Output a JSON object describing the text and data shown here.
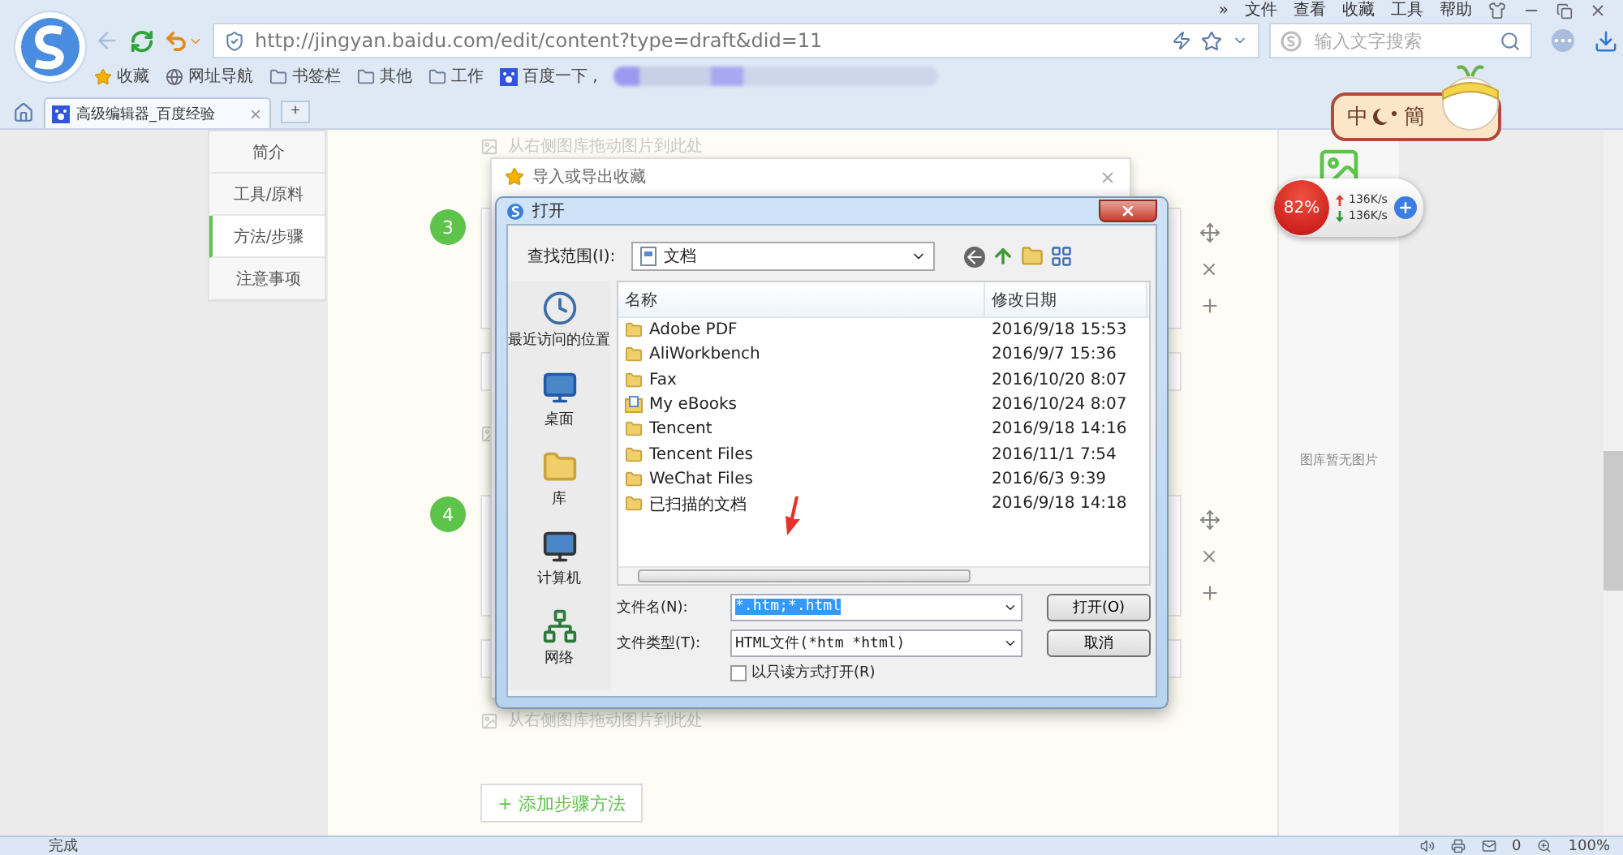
{
  "browser": {
    "more": "»",
    "menu": [
      "文件",
      "查看",
      "收藏",
      "工具",
      "帮助"
    ],
    "url": "http://jingyan.baidu.com/edit/content?type=draft&did=11",
    "search": {
      "placeholder": "输入文字搜索"
    },
    "bookmarks": [
      {
        "label": "收藏",
        "kind": "star"
      },
      {
        "label": "网址导航",
        "kind": "globe"
      },
      {
        "label": "书签栏",
        "kind": "folder"
      },
      {
        "label": "其他",
        "kind": "folder"
      },
      {
        "label": "工作",
        "kind": "folder"
      },
      {
        "label": "百度一下 ,",
        "kind": "paw"
      }
    ],
    "tabs": [
      {
        "label": "高级编辑器_百度经验",
        "selected": true
      }
    ],
    "new_tab": "+"
  },
  "nav": [
    {
      "label": "简介",
      "selected": false
    },
    {
      "label": "工具/原料",
      "selected": false
    },
    {
      "label": "方法/步骤",
      "selected": true
    },
    {
      "label": "注意事项",
      "selected": false
    }
  ],
  "editor": {
    "sections": [
      {
        "kind": "hint",
        "text": "从右侧图库拖动图片到此处"
      },
      {
        "kind": "step",
        "number": "3"
      },
      {
        "kind": "hint"
      },
      {
        "kind": "step",
        "number": "4"
      },
      {
        "kind": "hint",
        "text": "从右侧图库拖动图片到此处"
      }
    ],
    "add_button": "+ 添加步骤方法"
  },
  "gallery": {
    "empty": "图库暂无图片"
  },
  "back_dialog": {
    "title": "导入或导出收藏"
  },
  "open_dialog": {
    "title": "打开",
    "look_in_label": "查找范围(I):",
    "look_in": "文档",
    "places": [
      {
        "label": "最近访问的位置",
        "kind": "recent"
      },
      {
        "label": "桌面",
        "kind": "desktop"
      },
      {
        "label": "库",
        "kind": "library"
      },
      {
        "label": "计算机",
        "kind": "computer"
      },
      {
        "label": "网络",
        "kind": "network"
      }
    ],
    "columns": [
      "名称",
      "修改日期"
    ],
    "files": [
      {
        "name": "Adobe PDF",
        "date": "2016/9/18 15:53",
        "kind": "folder"
      },
      {
        "name": "AliWorkbench",
        "date": "2016/9/7 15:36",
        "kind": "folder"
      },
      {
        "name": "Fax",
        "date": "2016/10/20 8:07",
        "kind": "folder"
      },
      {
        "name": "My eBooks",
        "date": "2016/10/24 8:07",
        "kind": "ebooks"
      },
      {
        "name": "Tencent",
        "date": "2016/9/18 14:16",
        "kind": "folder"
      },
      {
        "name": "Tencent Files",
        "date": "2016/11/1 7:54",
        "kind": "folder"
      },
      {
        "name": "WeChat Files",
        "date": "2016/6/3 9:39",
        "kind": "folder"
      },
      {
        "name": "已扫描的文档",
        "date": "2016/9/18 14:18",
        "kind": "folder"
      }
    ],
    "file_name_label": "文件名(N):",
    "file_name": "*.htm;*.html",
    "file_type_label": "文件类型(T):",
    "file_type": "HTML文件(*htm *html)",
    "read_only": {
      "label": "以只读方式打开(R)",
      "checked": false
    },
    "buttons": [
      "打开(O)",
      "取消"
    ]
  },
  "speed_widget": {
    "percent": "82%",
    "up": "136K/s",
    "down": "136K/s"
  },
  "sticker": {
    "left": "中",
    "right": "簡"
  },
  "status": {
    "text": "完成",
    "count": "0",
    "zoom": "100%"
  }
}
